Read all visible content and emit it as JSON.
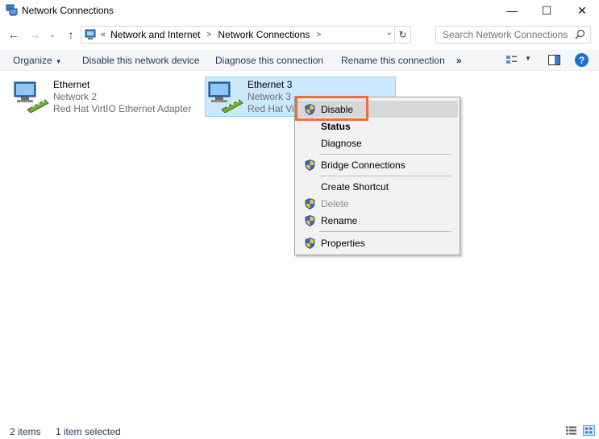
{
  "window": {
    "title": "Network Connections",
    "minimize": "—",
    "maximize": "☐",
    "close": "✕"
  },
  "address": {
    "overflow": "«",
    "crumbs": [
      "Network and Internet",
      "Network Connections"
    ],
    "search_placeholder": "Search Network Connections"
  },
  "nav": {
    "back": "←",
    "forward": "→",
    "recent": "⌄",
    "up": "↑",
    "refresh": "↻",
    "dropdown": "⌄"
  },
  "commands": {
    "organize": "Organize",
    "disable": "Disable this network device",
    "diagnose": "Diagnose this connection",
    "rename": "Rename this connection",
    "more": "»"
  },
  "items": [
    {
      "name": "Ethernet",
      "network": "Network  2",
      "adapter": "Red Hat VirtIO Ethernet Adapter",
      "icon": "network-adapter-icon",
      "selected": false
    },
    {
      "name": "Ethernet 3",
      "network": "Network  3",
      "adapter": "Red Hat VirtIO Ethernet Adapter",
      "icon": "network-adapter-icon",
      "selected": true
    }
  ],
  "context_menu": {
    "items": [
      {
        "label": "Disable",
        "shield": true,
        "bold": false,
        "disabled": false,
        "hover": true
      },
      {
        "label": "Status",
        "shield": false,
        "bold": true,
        "disabled": false
      },
      {
        "label": "Diagnose",
        "shield": false,
        "bold": false,
        "disabled": false
      },
      {
        "label": "Bridge Connections",
        "shield": true,
        "bold": false,
        "disabled": false
      },
      {
        "label": "Create Shortcut",
        "shield": false,
        "bold": false,
        "disabled": false
      },
      {
        "label": "Delete",
        "shield": true,
        "bold": false,
        "disabled": true
      },
      {
        "label": "Rename",
        "shield": true,
        "bold": false,
        "disabled": false
      },
      {
        "label": "Properties",
        "shield": true,
        "bold": false,
        "disabled": false
      }
    ]
  },
  "status": {
    "count": "2 items",
    "selected": "1 item selected"
  },
  "colors": {
    "selection_bg": "#cce8ff",
    "selection_border": "#99d1ff",
    "highlight_box": "#f26c3a",
    "command_text": "#1e395b"
  }
}
